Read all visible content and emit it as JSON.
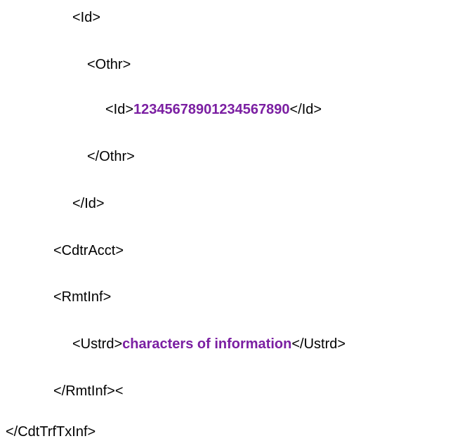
{
  "lines": {
    "l1": "<Id>",
    "l2": "<Othr>",
    "l3_open": "<Id>",
    "l3_value": "12345678901234567890",
    "l3_close": "</Id>",
    "l4": "</Othr>",
    "l5": "</Id>",
    "l6": "<CdtrAcct>",
    "l7": "<RmtInf>",
    "l8_open": "<Ustrd>",
    "l8_value": "characters of information",
    "l8_close": "</Ustrd>",
    "l9": "</RmtInf><",
    "l10": "</CdtTrfTxInf>"
  },
  "colors": {
    "value_highlight": "#7b1fa2",
    "text": "#000000"
  }
}
